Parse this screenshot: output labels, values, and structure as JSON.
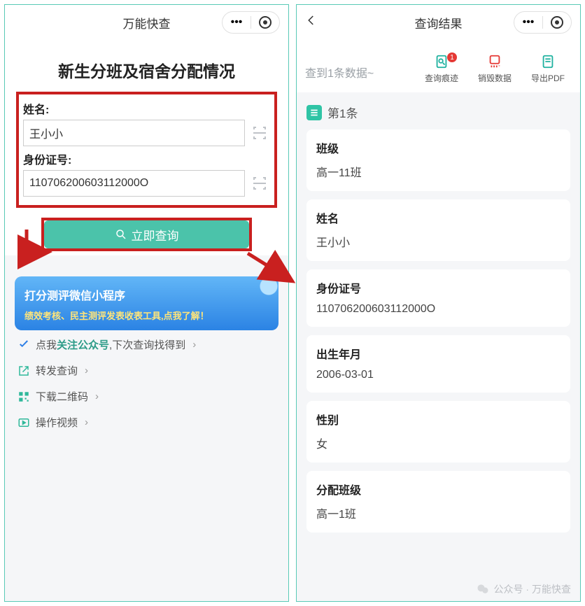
{
  "left": {
    "topbar_title": "万能快查",
    "hero_title": "新生分班及宿舍分配情况",
    "fields": {
      "name_label": "姓名:",
      "name_value": "王小小",
      "id_label": "身份证号:",
      "id_value": "110706200603112000O"
    },
    "query_button": "立即查询",
    "promo": {
      "line1": "打分测评微信小程序",
      "line2": "绩效考核、民主测评发表收表工具,点我了解！"
    },
    "links": {
      "follow_prefix": "点我",
      "follow_accent": "关注公众号",
      "follow_suffix": ",下次查询找得到",
      "forward": "转发查询",
      "qrcode": "下载二维码",
      "video": "操作视频"
    }
  },
  "right": {
    "topbar_title": "查询结果",
    "status_text": "查到1条数据~",
    "tools": {
      "trace": "查询痕迹",
      "trace_badge": "1",
      "destroy": "销毁数据",
      "export": "导出PDF"
    },
    "record_label": "第1条",
    "fields": [
      {
        "k": "班级",
        "v": "高一11班"
      },
      {
        "k": "姓名",
        "v": "王小小"
      },
      {
        "k": "身份证号",
        "v": "110706200603112000O"
      },
      {
        "k": "出生年月",
        "v": "2006-03-01"
      },
      {
        "k": "性别",
        "v": "女"
      },
      {
        "k": "分配班级",
        "v": "高一1班"
      }
    ]
  },
  "watermark": "公众号 · 万能快查"
}
